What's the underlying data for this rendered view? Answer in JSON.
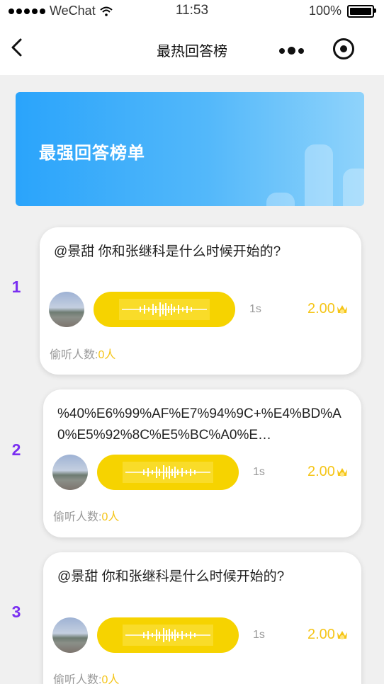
{
  "status": {
    "carrier": "WeChat",
    "time": "11:53",
    "battery": "100%"
  },
  "nav": {
    "title": "最热回答榜"
  },
  "banner": {
    "title": "最强回答榜单"
  },
  "answers": [
    {
      "rank": "1",
      "question": "@景甜 你和张继科是什么时候开始的?",
      "duration": "1s",
      "price": "2.00",
      "listen_label": "偷听人数:",
      "listen_count": "0人"
    },
    {
      "rank": "2",
      "question": "%40%E6%99%AF%E7%94%9C+%E4%BD%A0%E5%92%8C%E5%BC%A0%E…",
      "duration": "1s",
      "price": "2.00",
      "listen_label": "偷听人数:",
      "listen_count": "0人"
    },
    {
      "rank": "3",
      "question": "@景甜 你和张继科是什么时候开始的?",
      "duration": "1s",
      "price": "2.00",
      "listen_label": "偷听人数:",
      "listen_count": "0人"
    }
  ],
  "colors": {
    "rank": "#7a2ff1",
    "voice": "#f6d300",
    "price": "#f5c518",
    "banner": "#2aa4fb"
  },
  "icons": {
    "back": "back-chevron-icon",
    "more": "more-dots-icon",
    "close": "target-circle-icon",
    "coin": "crown-coin-icon",
    "wave": "sound-wave-icon",
    "wifi": "wifi-icon",
    "battery": "battery-icon"
  }
}
